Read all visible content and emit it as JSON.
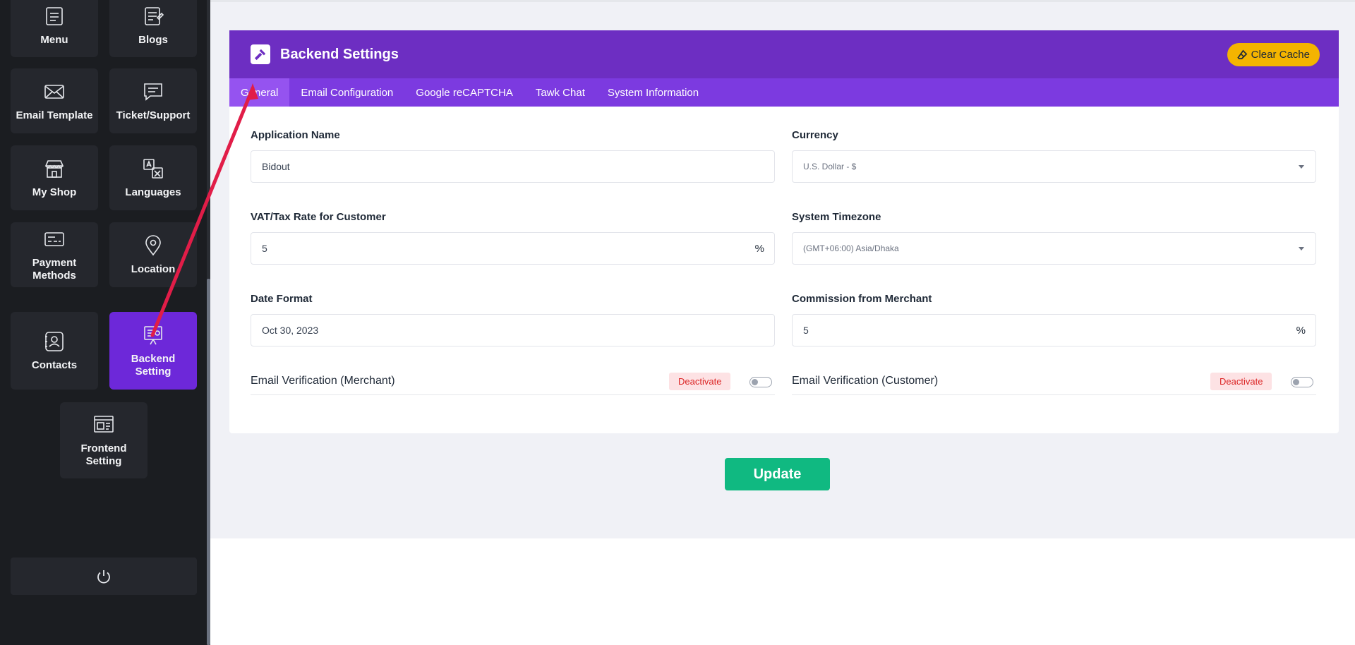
{
  "sidebar": {
    "tiles": [
      {
        "label": "Menu",
        "icon": "menu-icon"
      },
      {
        "label": "Blogs",
        "icon": "blog-icon"
      },
      {
        "label": "Email Template",
        "icon": "envelope-icon"
      },
      {
        "label": "Ticket/Support",
        "icon": "chat-icon"
      },
      {
        "label": "My Shop",
        "icon": "shop-icon"
      },
      {
        "label": "Languages",
        "icon": "translate-icon"
      },
      {
        "label": "Payment Methods",
        "icon": "card-icon"
      },
      {
        "label": "Location",
        "icon": "map-pin-icon"
      },
      {
        "label": "Contacts",
        "icon": "contacts-icon"
      },
      {
        "label": "Backend Setting",
        "icon": "backend-icon"
      },
      {
        "label": "Frontend Setting",
        "icon": "frontend-icon"
      }
    ],
    "active": "Backend Setting",
    "logout_icon": "power-icon"
  },
  "card": {
    "title": "Backend Settings",
    "clear_cache_label": "Clear Cache",
    "tabs": [
      "General",
      "Email Configuration",
      "Google reCAPTCHA",
      "Tawk Chat",
      "System Information"
    ],
    "active_tab": "General"
  },
  "form": {
    "app_name": {
      "label": "Application Name",
      "value": "Bidout"
    },
    "currency": {
      "label": "Currency",
      "value": "U.S. Dollar - $"
    },
    "vat": {
      "label": "VAT/Tax Rate for Customer",
      "value": "5",
      "suffix": "%"
    },
    "timezone": {
      "label": "System Timezone",
      "value": "(GMT+06:00) Asia/Dhaka"
    },
    "date_format": {
      "label": "Date Format",
      "value": "Oct 30, 2023"
    },
    "commission": {
      "label": "Commission from Merchant",
      "value": "5",
      "suffix": "%"
    },
    "verify_merchant": {
      "label": "Email Verification (Merchant)",
      "status": "Deactivate",
      "enabled": false
    },
    "verify_customer": {
      "label": "Email Verification (Customer)",
      "status": "Deactivate",
      "enabled": false
    }
  },
  "update_label": "Update",
  "colors": {
    "sidebar_bg": "#1b1d21",
    "tile_bg": "#25272d",
    "active_purple": "#6d28d9",
    "header_purple": "#6d2ec2",
    "tab_purple": "#7c3ae0",
    "clear_cache": "#f4b400",
    "update_green": "#10b981",
    "badge_red": "#dc2626",
    "annotation_red": "#e11d48"
  }
}
